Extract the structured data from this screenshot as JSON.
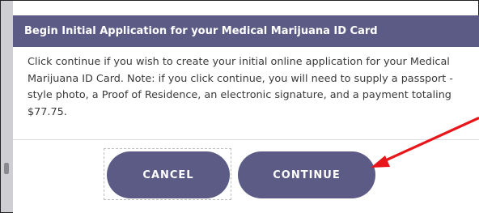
{
  "dialog": {
    "title": "Begin Initial Application for your Medical Marijuana ID Card",
    "body": "Click continue if you wish to create your initial online application for your Medical Marijuana ID Card. Note: if you click continue, you will need to supply a passport - style photo, a Proof of Residence, an electronic signature, and a payment totaling $77.75.",
    "buttons": {
      "cancel_label": "CANCEL",
      "continue_label": "CONTINUE"
    }
  },
  "colors": {
    "header_bg": "#5b5b85",
    "button_bg": "#5b5b85",
    "annotation_arrow": "#e8161b"
  },
  "annotation": {
    "icon": "red-arrow-icon"
  }
}
